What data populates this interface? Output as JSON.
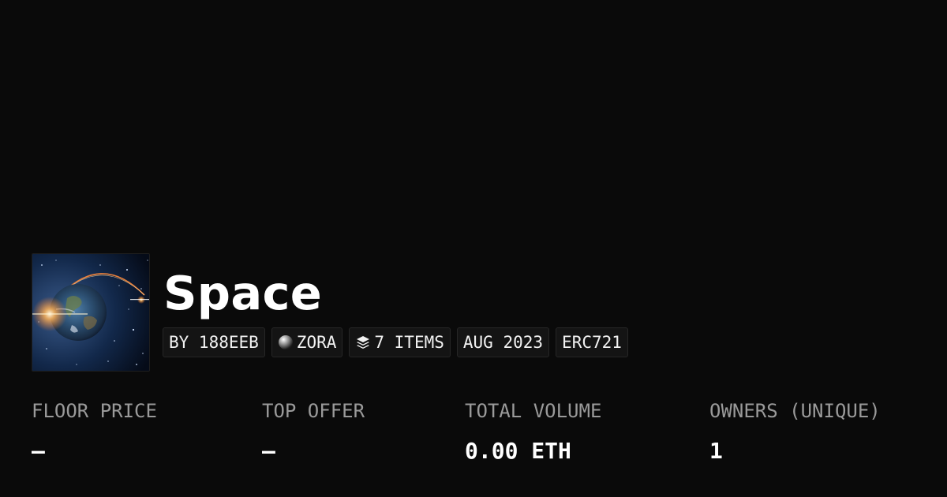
{
  "collection": {
    "title": "Space",
    "thumbnail_icon": "planet-earth-in-space-image"
  },
  "tags": {
    "creator": "BY 188EEB",
    "chain": "ZORA",
    "chain_icon": "zora-orb-icon",
    "items": "7 ITEMS",
    "items_icon": "layers-icon",
    "date": "AUG 2023",
    "standard": "ERC721"
  },
  "stats": {
    "floor_price": {
      "label": "FLOOR PRICE",
      "value": "—"
    },
    "top_offer": {
      "label": "TOP OFFER",
      "value": "—"
    },
    "total_volume": {
      "label": "TOTAL VOLUME",
      "value": "0.00 ETH"
    },
    "owners": {
      "label": "OWNERS (UNIQUE)",
      "value": "1"
    }
  },
  "colors": {
    "background": "#0a0a0a",
    "tag_background": "#141414",
    "label_gray": "#9a9a9a",
    "text": "#ffffff"
  }
}
